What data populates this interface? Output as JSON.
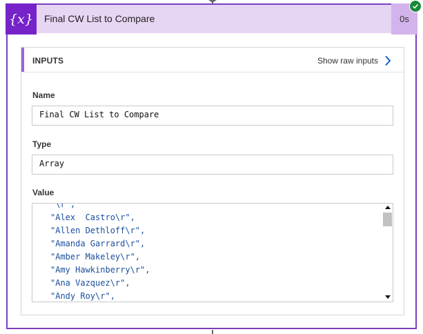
{
  "action": {
    "icon": "variable-icon",
    "icon_glyph": "{x}",
    "title": "Final CW List to Compare",
    "duration": "0s",
    "status": "succeeded",
    "accent_color": "#7623c9",
    "header_color": "#e7d5f4"
  },
  "inputs": {
    "section_label": "INPUTS",
    "raw_link": "Show raw inputs",
    "name_label": "Name",
    "name_value": "Final CW List to Compare",
    "type_label": "Type",
    "type_value": "Array",
    "value_label": "Value",
    "value_lines": [
      "\"\\r\",",
      "\"Alex  Castro\\r\",",
      "\"Allen Dethloff\\r\",",
      "\"Amanda Garrard\\r\",",
      "\"Amber Makeley\\r\",",
      "\"Amy Hawkinberry\\r\",",
      "\"Ana Vazquez\\r\",",
      "\"Andy Roy\\r\","
    ]
  }
}
